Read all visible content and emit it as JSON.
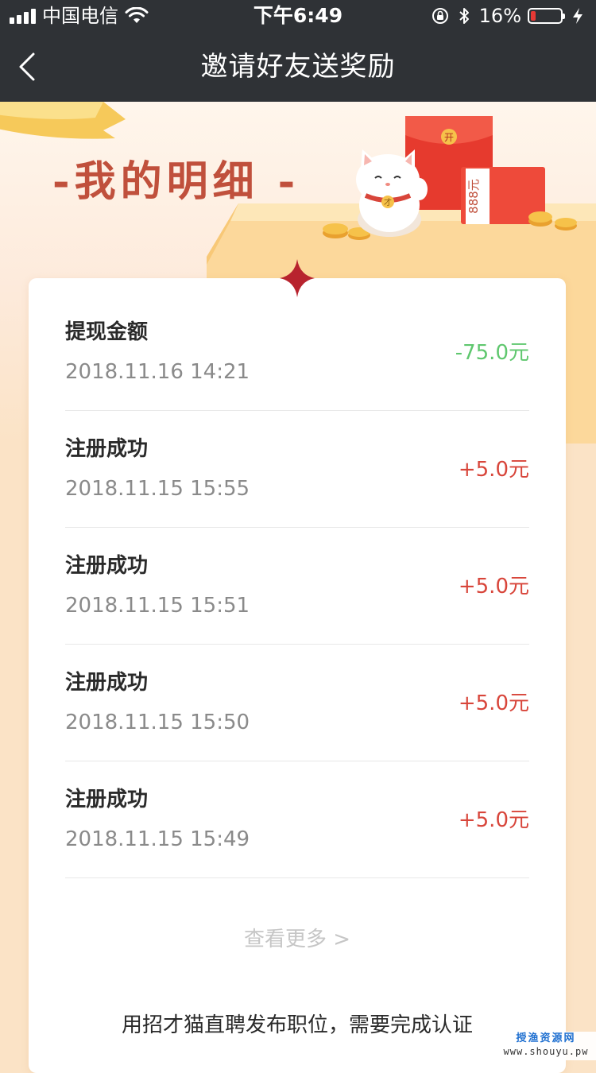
{
  "status_bar": {
    "carrier": "中国电信",
    "time": "下午6:49",
    "battery_percent": "16%",
    "battery_level": 0.16,
    "battery_color": "#e53935",
    "icons": [
      "signal-icon",
      "wifi-icon",
      "orientation-lock-icon",
      "bluetooth-icon",
      "battery-icon",
      "charging-icon"
    ]
  },
  "nav": {
    "title": "邀请好友送奖励",
    "back_icon": "chevron-left-icon"
  },
  "banner": {
    "title": "-我的明细 -",
    "envelope_text": "888元",
    "envelope_seal": "开",
    "cat_collar": "才"
  },
  "records": [
    {
      "title": "提现金额",
      "time": "2018.11.16 14:21",
      "amount": "-75.0元",
      "type": "negative"
    },
    {
      "title": "注册成功",
      "time": "2018.11.15 15:55",
      "amount": "+5.0元",
      "type": "positive"
    },
    {
      "title": "注册成功",
      "time": "2018.11.15 15:51",
      "amount": "+5.0元",
      "type": "positive"
    },
    {
      "title": "注册成功",
      "time": "2018.11.15 15:50",
      "amount": "+5.0元",
      "type": "positive"
    },
    {
      "title": "注册成功",
      "time": "2018.11.15 15:49",
      "amount": "+5.0元",
      "type": "positive"
    }
  ],
  "more_link": "查看更多 >",
  "footer_text": "用招才猫直聘发布职位，需要完成认证",
  "watermark": {
    "line1": "授渔资源网",
    "line2": "www.shouyu.pw"
  },
  "colors": {
    "nav_bg": "#2f3236",
    "positive": "#d8453a",
    "negative": "#5fc76e",
    "banner_title": "#c0503c"
  }
}
